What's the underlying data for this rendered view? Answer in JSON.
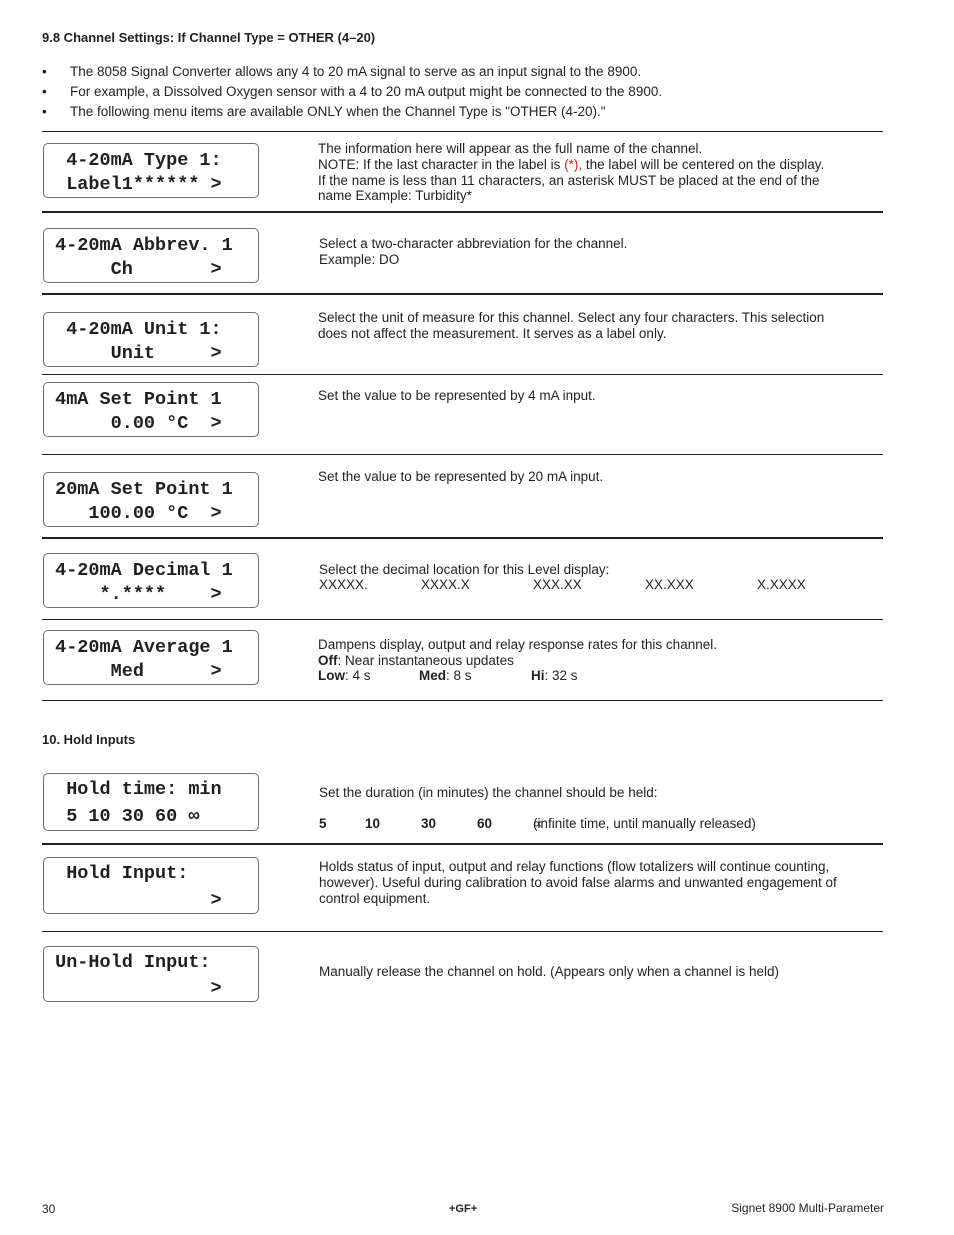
{
  "section_98": {
    "heading": "9.8  Channel Settings: If Channel Type = OTHER (4–20)",
    "bullets": [
      "The 8058 Signal Converter allows any 4 to 20 mA signal to serve as an input signal to the 8900.",
      "For example, a Dissolved Oxygen sensor with a 4 to 20 mA output might be connected to the 8900.",
      "The following menu items are available ONLY when the Channel Type is \"OTHER (4-20).\""
    ],
    "bullet_char": "•",
    "items": [
      {
        "lcd_line1": "  4-20mA Type 1:",
        "lcd_line2": "  Label1****** >",
        "desc_lines": [
          "The information here will appear as the full name of the channel."
        ],
        "note_prefix": "NOTE:  If the last character in the label is  ",
        "note_red": "(*),",
        "note_suffix": " the label will be centered on the display.",
        "desc_more": [
          "If the name is less than 11 characters, an asterisk MUST be placed at the end of the",
          "name   Example:  Turbidity*"
        ]
      },
      {
        "lcd_line1": " 4-20mA Abbrev. 1",
        "lcd_line2": "      Ch       >",
        "desc_lines": [
          "Select a two-character abbreviation for the channel.",
          "Example:  DO"
        ]
      },
      {
        "lcd_line1": "  4-20mA Unit 1:",
        "lcd_line2": "      Unit     >",
        "desc_lines": [
          "Select the unit of measure for this channel.  Select any four characters.  This selection",
          "does not affect the measurement.  It serves as a label only."
        ]
      },
      {
        "lcd_line1": " 4mA Set Point 1",
        "lcd_line2": "      0.00 °C  >",
        "desc_lines": [
          "Set the value to be represented by 4 mA input."
        ]
      },
      {
        "lcd_line1": " 20mA Set Point 1",
        "lcd_line2": "    100.00 °C  >",
        "desc_lines": [
          "Set the value to be represented by 20 mA input."
        ]
      },
      {
        "lcd_line1": " 4-20mA Decimal 1",
        "lcd_line2": "     *.****    >",
        "desc_lines": [
          "Select the decimal location for this Level display:"
        ],
        "options": [
          "XXXXX.",
          "XXXX.X",
          "XXX.XX",
          "XX.XXX",
          "X.XXXX"
        ]
      },
      {
        "lcd_line1": " 4-20mA Average 1",
        "lcd_line2": "      Med      >",
        "desc_lines": [
          "Dampens display, output and relay response rates for this channel."
        ],
        "off_label": "Off",
        "off_text": ":  Near instantaneous updates",
        "rates": [
          {
            "label": "Low",
            "value": ": 4 s"
          },
          {
            "label": "Med",
            "value": ":  8 s"
          },
          {
            "label": "Hi",
            "value": ": 32 s"
          }
        ]
      }
    ]
  },
  "section_10": {
    "heading": "10.  Hold Inputs",
    "items": [
      {
        "lcd_line1": "  Hold time: min",
        "lcd_line2": "  5 10 30 60 ∞",
        "desc_lines": [
          "Set the duration (in minutes) the channel should be held:"
        ],
        "values": [
          "5",
          "10",
          "30",
          "60"
        ],
        "infinite_symbol": "∝",
        "infinite_text": " (infinite time, until manually released)"
      },
      {
        "lcd_line1": "  Hold Input:",
        "lcd_line2": "               >",
        "desc_lines": [
          "Holds status of input, output and relay functions (flow totalizers will continue counting,",
          "however).  Useful during calibration to avoid false alarms and unwanted engagement of",
          "control equipment."
        ]
      },
      {
        "lcd_line1": " Un-Hold Input:",
        "lcd_line2": "               >",
        "desc_lines": [
          "Manually release the channel on hold. (Appears only when a channel is held)"
        ]
      }
    ]
  },
  "footer": {
    "page_number": "30",
    "logo": "+GF+",
    "product": "Signet 8900 Multi-Parameter"
  }
}
